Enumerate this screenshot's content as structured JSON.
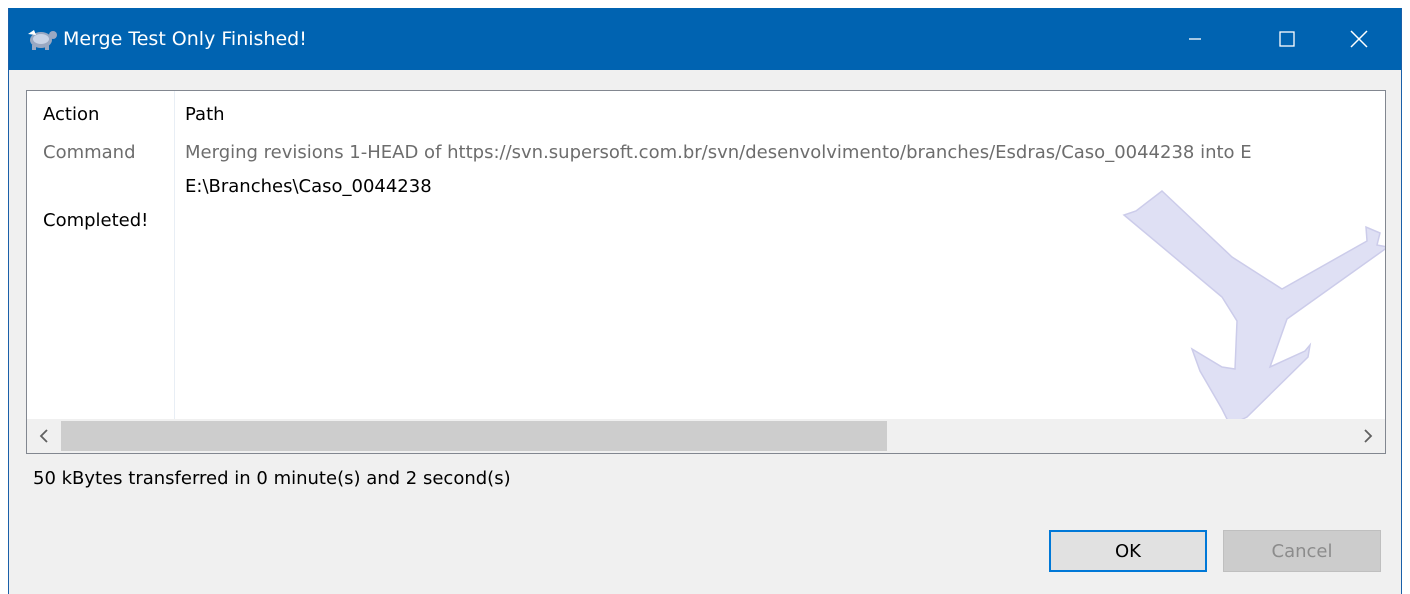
{
  "window": {
    "title": "Merge Test Only Finished!",
    "app_icon": "tortoise-icon",
    "controls": [
      "minimize-icon",
      "maximize-icon",
      "close-icon"
    ]
  },
  "list": {
    "columns": [
      "Action",
      "Path"
    ],
    "rows": [
      {
        "action": "Command",
        "path": "Merging revisions 1-HEAD of https://svn.supersoft.com.br/svn/desenvolvimento/branches/Esdras/Caso_0044238 into E"
      },
      {
        "action": "",
        "path": "E:\\Branches\\Caso_0044238"
      },
      {
        "action": "Completed!",
        "path": ""
      }
    ]
  },
  "status": {
    "transfer_text": "50 kBytes transferred in 0 minute(s) and 2 second(s)"
  },
  "buttons": {
    "ok": "OK",
    "cancel": "Cancel"
  },
  "colors": {
    "titlebar": "#0063b1",
    "command_text": "#6d6d6d",
    "ok_border": "#0078d7"
  }
}
